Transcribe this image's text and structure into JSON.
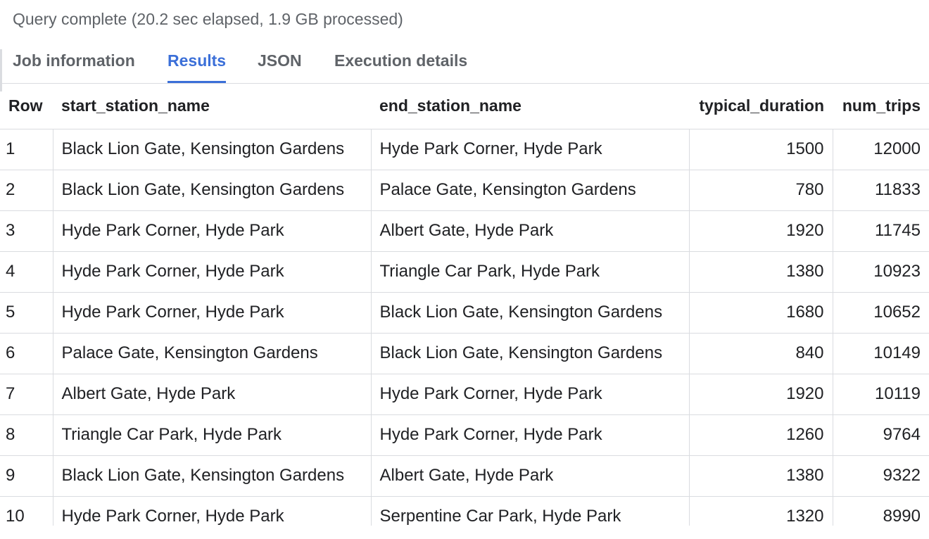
{
  "status_text": "Query complete (20.2 sec elapsed, 1.9 GB processed)",
  "tabs": [
    {
      "label": "Job information",
      "active": false
    },
    {
      "label": "Results",
      "active": true
    },
    {
      "label": "JSON",
      "active": false
    },
    {
      "label": "Execution details",
      "active": false
    }
  ],
  "colors": {
    "accent": "#3b6fd8",
    "muted_text": "#5f6368",
    "text": "#202124",
    "border": "#dadce0"
  },
  "table": {
    "columns": [
      "Row",
      "start_station_name",
      "end_station_name",
      "typical_duration",
      "num_trips"
    ],
    "rows": [
      [
        "1",
        "Black Lion Gate, Kensington Gardens",
        "Hyde Park Corner, Hyde Park",
        "1500",
        "12000"
      ],
      [
        "2",
        "Black Lion Gate, Kensington Gardens",
        "Palace Gate, Kensington Gardens",
        "780",
        "11833"
      ],
      [
        "3",
        "Hyde Park Corner, Hyde Park",
        "Albert Gate, Hyde Park",
        "1920",
        "11745"
      ],
      [
        "4",
        "Hyde Park Corner, Hyde Park",
        "Triangle Car Park, Hyde Park",
        "1380",
        "10923"
      ],
      [
        "5",
        "Hyde Park Corner, Hyde Park",
        "Black Lion Gate, Kensington Gardens",
        "1680",
        "10652"
      ],
      [
        "6",
        "Palace Gate, Kensington Gardens",
        "Black Lion Gate, Kensington Gardens",
        "840",
        "10149"
      ],
      [
        "7",
        "Albert Gate, Hyde Park",
        "Hyde Park Corner, Hyde Park",
        "1920",
        "10119"
      ],
      [
        "8",
        "Triangle Car Park, Hyde Park",
        "Hyde Park Corner, Hyde Park",
        "1260",
        "9764"
      ],
      [
        "9",
        "Black Lion Gate, Kensington Gardens",
        "Albert Gate, Hyde Park",
        "1380",
        "9322"
      ],
      [
        "10",
        "Hyde Park Corner, Hyde Park",
        "Serpentine Car Park, Hyde Park",
        "1320",
        "8990"
      ]
    ]
  }
}
